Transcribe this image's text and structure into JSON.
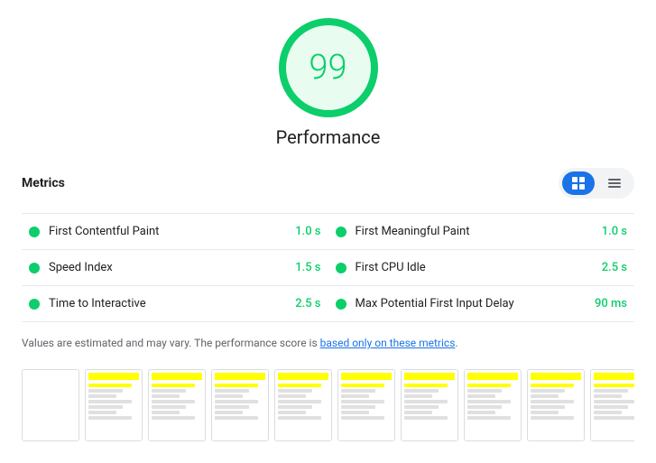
{
  "score": {
    "value": "99",
    "label": "Performance",
    "circle_color": "#0cce6b"
  },
  "metrics_section": {
    "title": "Metrics",
    "toggle": {
      "list_label": "≡",
      "grid_label": "⊟"
    }
  },
  "metrics": [
    {
      "name": "First Contentful Paint",
      "value": "1.0 s",
      "color": "#0cce6b"
    },
    {
      "name": "First Meaningful Paint",
      "value": "1.0 s",
      "color": "#0cce6b"
    },
    {
      "name": "Speed Index",
      "value": "1.5 s",
      "color": "#0cce6b"
    },
    {
      "name": "First CPU Idle",
      "value": "2.5 s",
      "color": "#0cce6b"
    },
    {
      "name": "Time to Interactive",
      "value": "2.5 s",
      "color": "#0cce6b"
    },
    {
      "name": "Max Potential First Input Delay",
      "value": "90 ms",
      "color": "#0cce6b"
    }
  ],
  "footer": {
    "text_before": "Values are estimated and may vary. The performance score is ",
    "link_text": "based only on these metrics",
    "text_after": "."
  }
}
